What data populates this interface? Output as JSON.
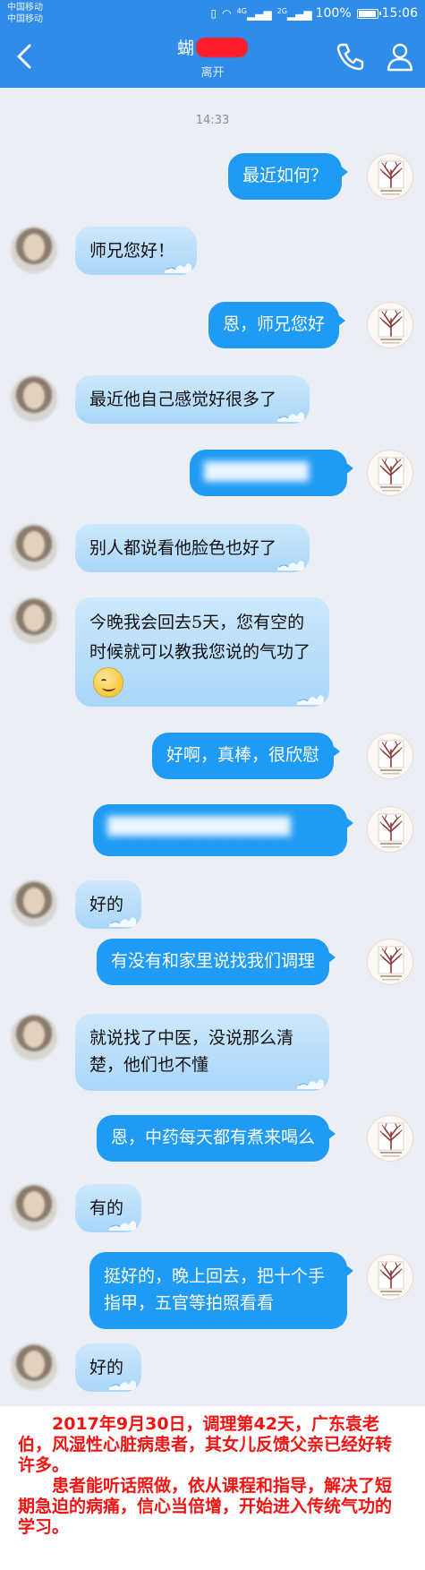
{
  "status_bar": {
    "carrier_1": "中国移动",
    "carrier_2": "中国移动",
    "network_1": "4G",
    "network_2": "2G",
    "battery": "100%",
    "battery_level": 1.0,
    "time": "15:06"
  },
  "header": {
    "contact_name": "蝴",
    "status": "离开",
    "back_icon": "chevron-left-icon",
    "call_icon": "phone-icon",
    "profile_icon": "user-icon"
  },
  "chat": {
    "timestamp": "14:33",
    "messages": [
      {
        "side": "out",
        "text": "最近如何？"
      },
      {
        "side": "in",
        "text": "师兄您好！"
      },
      {
        "side": "out",
        "text": "恩，师兄您好"
      },
      {
        "side": "in",
        "text": "最近他自己感觉好很多了"
      },
      {
        "side": "out",
        "text": "",
        "blurred": true
      },
      {
        "side": "in",
        "text": "别人都说看他脸色也好了"
      },
      {
        "side": "in",
        "text": "今晚我会回去5天，您有空的时候就可以教我您说的气功了"
      },
      {
        "side": "out",
        "text": "好啊，真棒，很欣慰"
      },
      {
        "side": "out",
        "text": "",
        "blurred": true
      },
      {
        "side": "in",
        "text": "好的"
      },
      {
        "side": "out",
        "text": "有没有和家里说找我们调理"
      },
      {
        "side": "in",
        "text": "就说找了中医，没说那么清楚，他们也不懂"
      },
      {
        "side": "out",
        "text": "恩，中药每天都有煮来喝么"
      },
      {
        "side": "in",
        "text": "有的"
      },
      {
        "side": "out",
        "text": "挺好的，晚上回去，把十个手指甲，五官等拍照看看"
      },
      {
        "side": "in",
        "text": "好的"
      }
    ]
  },
  "caption": {
    "line1": "2017年9月30日，调理第42天，广东袁老伯，风湿性心脏病患者，其女儿反馈父亲已经好转许多。",
    "line2": "患者能听话照做，依从课程和指导，解决了短期急迫的病痛，信心当倍增，开始进入传统气功的学习。"
  },
  "colors": {
    "header_blue": "#2f8ce8",
    "outgoing_bubble": "#1f9bf3",
    "incoming_bubble": "#b9defa",
    "caption_red": "#f01412",
    "chat_background": "#eceef5"
  }
}
